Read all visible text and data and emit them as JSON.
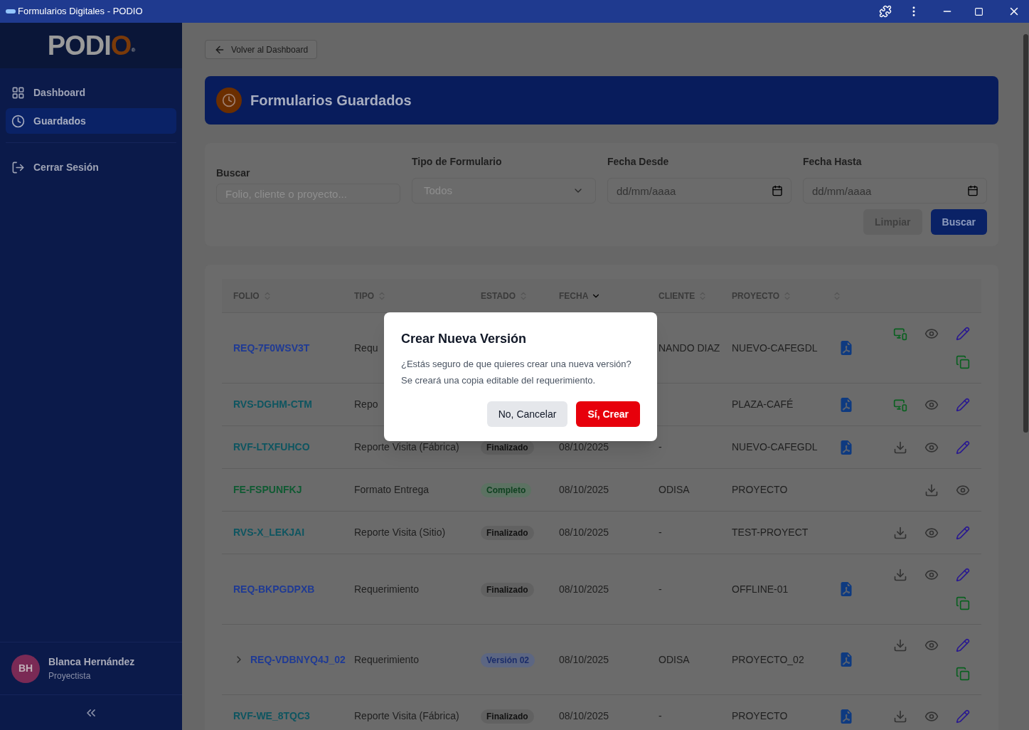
{
  "window": {
    "title": "Formularios Digitales - PODIO"
  },
  "sidebar": {
    "logo": {
      "text": "PODI",
      "accent": "O",
      "mark": "®"
    },
    "items": [
      {
        "label": "Dashboard",
        "selected": false
      },
      {
        "label": "Guardados",
        "selected": true
      }
    ],
    "logout": {
      "label": "Cerrar Sesión"
    },
    "user": {
      "initials": "BH",
      "name": "Blanca Hernández",
      "role": "Proyectista"
    }
  },
  "back_button": {
    "label": "Volver al Dashboard"
  },
  "banner": {
    "title": "Formularios Guardados"
  },
  "filters": {
    "fields": [
      {
        "kind": "text",
        "label": "Buscar",
        "placeholder": "Folio, cliente o proyecto..."
      },
      {
        "kind": "select",
        "label": "Tipo de Formulario",
        "value": "Todos"
      },
      {
        "kind": "date",
        "label": "Fecha Desde",
        "placeholder": "dd/mm/aaaa"
      },
      {
        "kind": "date",
        "label": "Fecha Hasta",
        "placeholder": "dd/mm/aaaa"
      }
    ],
    "buttons": [
      {
        "label": "Limpiar",
        "disabled": true
      },
      {
        "label": "Buscar",
        "disabled": false
      }
    ]
  },
  "table": {
    "columns": [
      {
        "label": "FOLIO",
        "sorted": false
      },
      {
        "label": "TIPO",
        "sorted": false
      },
      {
        "label": "ESTADO",
        "sorted": false
      },
      {
        "label": "FECHA",
        "sorted": true
      },
      {
        "label": "CLIENTE",
        "sorted": false
      },
      {
        "label": "PROYECTO",
        "sorted": false
      },
      {
        "sorted": false
      }
    ],
    "rows": [
      {
        "folio": "REQ-7F0WSV3T",
        "color": "#1f3a94",
        "tipo": "Requ",
        "cliente": "NANDO DIAZ",
        "proyecto": "NUEVO-CAFEGDL",
        "pdf": true,
        "actions": [
          {
            "kind": "sync"
          },
          {
            "kind": "view"
          },
          {
            "kind": "edit"
          },
          {
            "kind": "copy"
          }
        ]
      },
      {
        "folio": "RVS-DGHM-CTM",
        "color": "#0e5560",
        "tipo": "Repo",
        "proyecto": "PLAZA-CAFÉ",
        "pdf": true,
        "actions": [
          {
            "kind": "sync"
          },
          {
            "kind": "view"
          },
          {
            "kind": "edit"
          }
        ]
      },
      {
        "folio": "RVF-LTXFUHCO",
        "color": "#0e5560",
        "tipo": "Reporte Visita (Fábrica)",
        "estado": {
          "text": "Finalizado",
          "kind": "neutral"
        },
        "fecha": "08/10/2025",
        "cliente": "-",
        "proyecto": "NUEVO-CAFEGDL",
        "pdf": true,
        "actions": [
          {
            "kind": "download"
          },
          {
            "kind": "view"
          },
          {
            "kind": "edit"
          }
        ]
      },
      {
        "folio": "FE-FSPUNFKJ",
        "color": "#0f5a32",
        "tipo": "Formato Entrega",
        "estado": {
          "text": "Completo",
          "kind": "success"
        },
        "fecha": "08/10/2025",
        "cliente": "ODISA",
        "proyecto": "PROYECTO",
        "pdf": false,
        "actions": [
          {
            "kind": "download"
          },
          {
            "kind": "view"
          }
        ]
      },
      {
        "folio": "RVS-X_LEKJAI",
        "color": "#0e5560",
        "tipo": "Reporte Visita (Sitio)",
        "estado": {
          "text": "Finalizado",
          "kind": "neutral"
        },
        "fecha": "08/10/2025",
        "cliente": "-",
        "proyecto": "TEST-PROYECT",
        "pdf": false,
        "actions": [
          {
            "kind": "download"
          },
          {
            "kind": "view"
          },
          {
            "kind": "edit"
          }
        ]
      },
      {
        "folio": "REQ-BKPGDPXB",
        "color": "#1f3a94",
        "tipo": "Requerimiento",
        "estado": {
          "text": "Finalizado",
          "kind": "neutral"
        },
        "fecha": "08/10/2025",
        "cliente": "-",
        "proyecto": "OFFLINE-01",
        "pdf": true,
        "actions": [
          {
            "kind": "download"
          },
          {
            "kind": "view"
          },
          {
            "kind": "edit"
          },
          {
            "kind": "copy"
          }
        ]
      },
      {
        "folio": "REQ-VDBNYQ4J_02",
        "color": "#1f3a94",
        "expanded": false,
        "tipo": "Requerimiento",
        "estado": {
          "text": "Versión 02",
          "kind": "info"
        },
        "fecha": "08/10/2025",
        "cliente": "ODISA",
        "proyecto": "PROYECTO_02",
        "pdf": true,
        "actions": [
          {
            "kind": "download"
          },
          {
            "kind": "view"
          },
          {
            "kind": "edit"
          },
          {
            "kind": "copy"
          }
        ]
      },
      {
        "folio": "RVF-WE_8TQC3",
        "color": "#0e5560",
        "tipo": "Reporte Visita (Fábrica)",
        "estado": {
          "text": "Finalizado",
          "kind": "neutral"
        },
        "fecha": "08/10/2025",
        "cliente": "-",
        "proyecto": "PROYECTO",
        "pdf": true,
        "actions": [
          {
            "kind": "download"
          },
          {
            "kind": "view"
          },
          {
            "kind": "edit"
          }
        ]
      }
    ]
  },
  "dialog": {
    "title": "Crear Nueva Versión",
    "message": [
      "¿Estás seguro de que quieres crear una nueva versión?",
      "Se creará una copia editable del requerimiento."
    ],
    "buttons": [
      {
        "label": "No, Cancelar",
        "kind": "secondary"
      },
      {
        "label": "Sí, Crear",
        "kind": "primary"
      }
    ]
  }
}
